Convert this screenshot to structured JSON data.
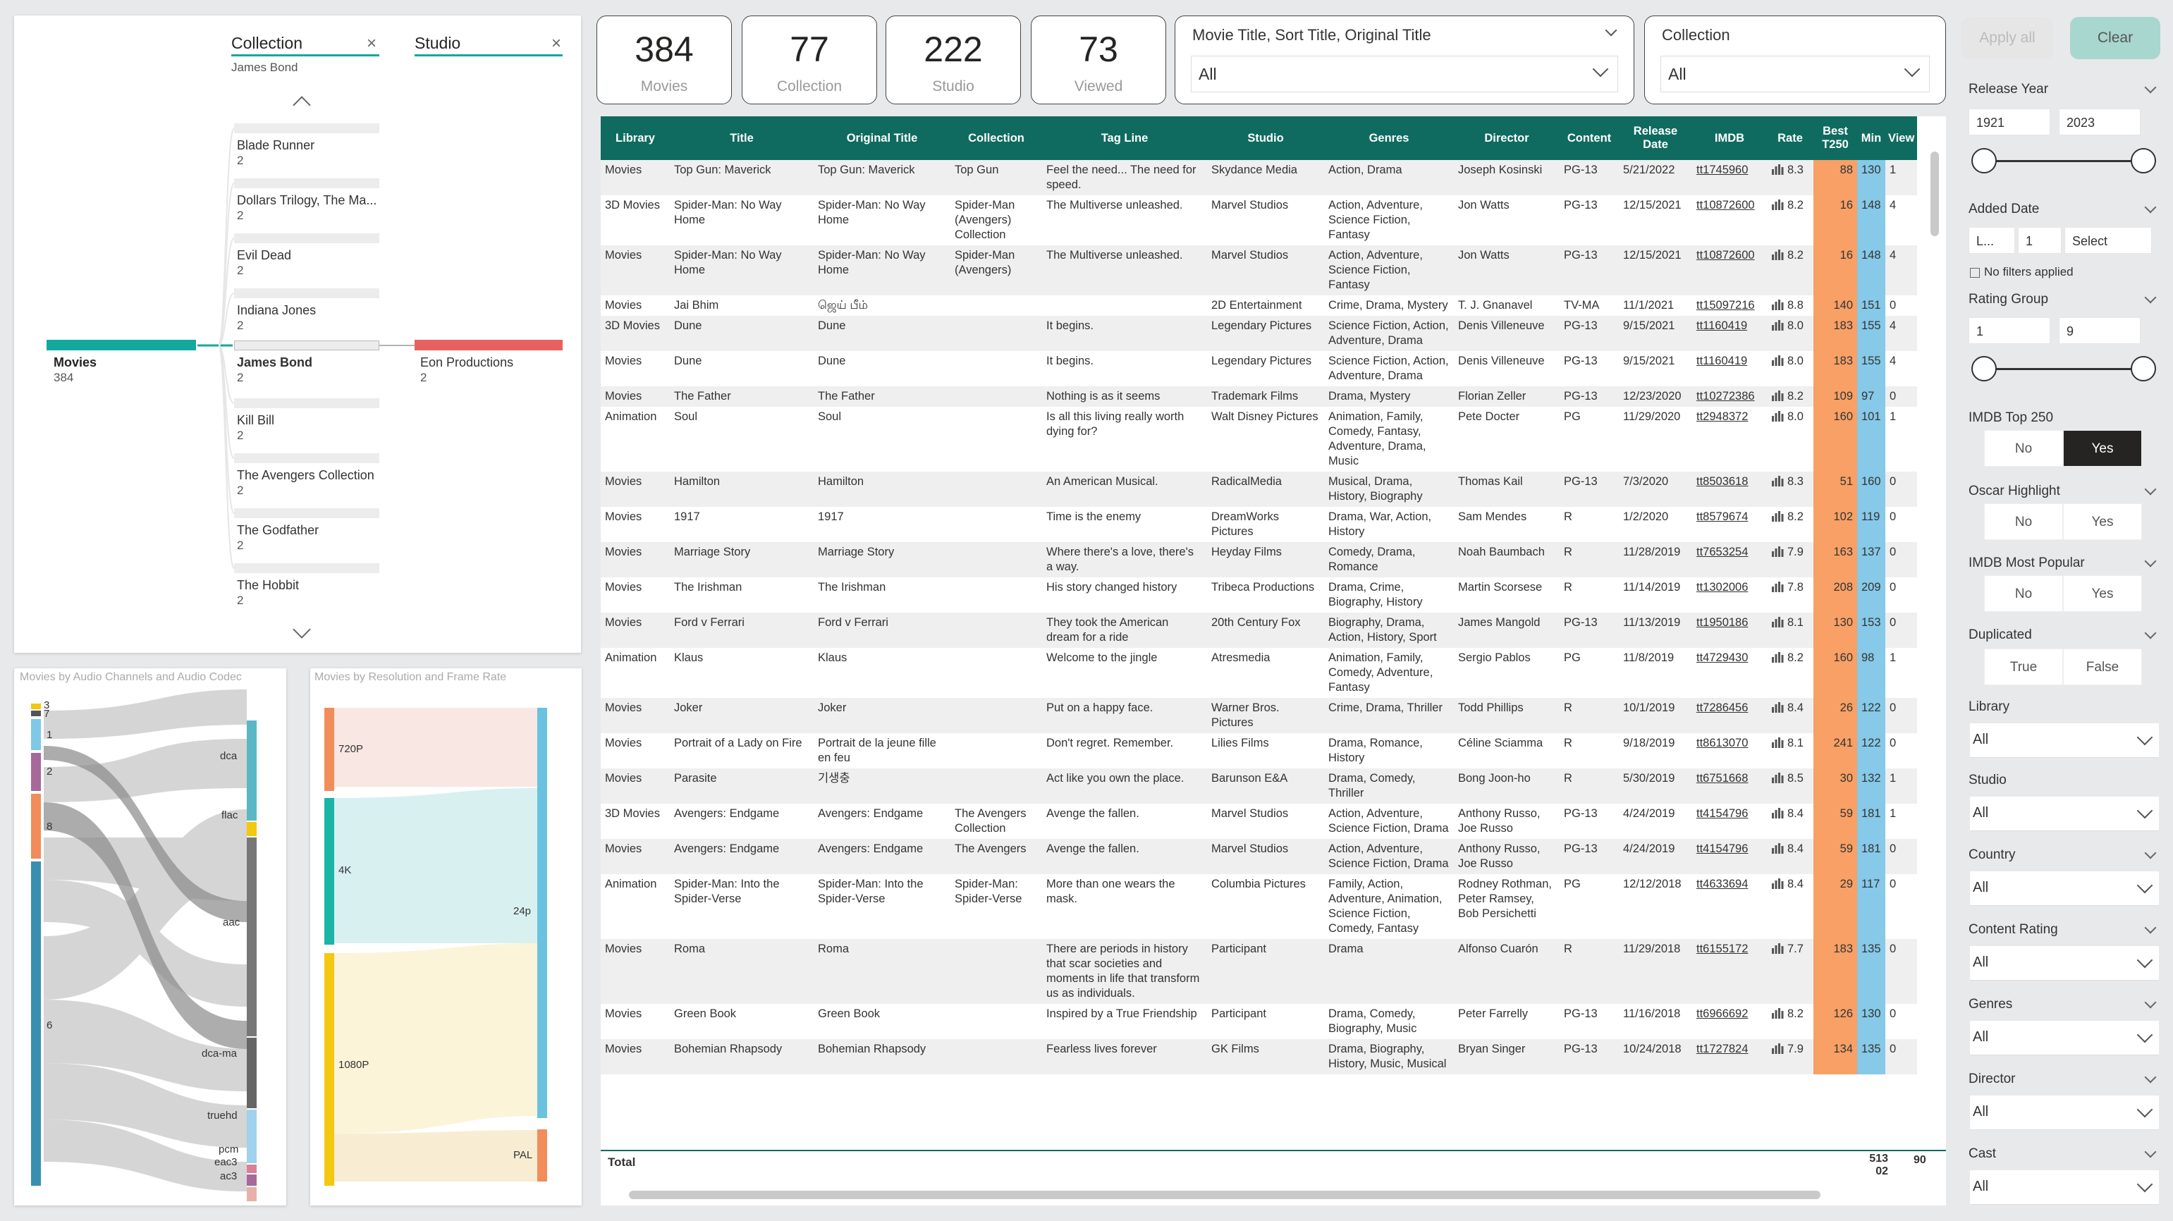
{
  "decomp": {
    "col1": {
      "header": "Collection",
      "filter": "James Bond"
    },
    "col2": {
      "header": "Studio"
    },
    "root": {
      "label": "Movies",
      "value": "384"
    },
    "nodes": [
      {
        "label": "Blade Runner",
        "value": "2"
      },
      {
        "label": "Dollars Trilogy, The Ma...",
        "value": "2"
      },
      {
        "label": "Evil Dead",
        "value": "2"
      },
      {
        "label": "Indiana Jones",
        "value": "2"
      },
      {
        "label": "James Bond",
        "value": "2"
      },
      {
        "label": "Kill Bill",
        "value": "2"
      },
      {
        "label": "The Avengers Collection",
        "value": "2"
      },
      {
        "label": "The Godfather",
        "value": "2"
      },
      {
        "label": "The Hobbit",
        "value": "2"
      }
    ],
    "studio_node": {
      "label": "Eon Productions",
      "value": "2"
    }
  },
  "audio_chart": {
    "title": "Movies by Audio Channels and Audio Codec",
    "left_labels": [
      "3",
      "7",
      "1",
      "2",
      "8",
      "6"
    ],
    "right_labels": [
      "dca",
      "flac",
      "aac",
      "dca-ma",
      "truehd",
      "pcm",
      "eac3",
      "ac3"
    ]
  },
  "res_chart": {
    "title": "Movies by Resolution and Frame Rate",
    "left_labels": [
      "720P",
      "4K",
      "1080P"
    ],
    "right_labels": [
      "24p",
      "PAL"
    ]
  },
  "kpis": [
    {
      "value": "384",
      "label": "Movies"
    },
    {
      "value": "77",
      "label": "Collection"
    },
    {
      "value": "222",
      "label": "Studio"
    },
    {
      "value": "73",
      "label": "Viewed"
    }
  ],
  "title_slicer": {
    "header": "Movie Title, Sort Title, Original Title",
    "value": "All"
  },
  "collection_slicer": {
    "header": "Collection",
    "value": "All"
  },
  "buttons": {
    "apply": "Apply all",
    "clear": "Clear"
  },
  "table": {
    "columns": [
      "Library",
      "Title",
      "Original Title",
      "Collection",
      "Tag Line",
      "Studio",
      "Genres",
      "Director",
      "Content",
      "Release Date",
      "IMDB",
      "Rate",
      "Best T250",
      "Min",
      "View"
    ],
    "rows": [
      [
        "Movies",
        "Top Gun: Maverick",
        "Top Gun: Maverick",
        "Top Gun",
        "Feel the need... The need for speed.",
        "Skydance Media",
        "Action, Drama",
        "Joseph Kosinski",
        "PG-13",
        "5/21/2022",
        "tt1745960",
        "8.3",
        "88",
        "130",
        "1"
      ],
      [
        "3D Movies",
        "Spider-Man: No Way Home",
        "Spider-Man: No Way Home",
        "Spider-Man (Avengers) Collection",
        "The Multiverse unleashed.",
        "Marvel Studios",
        "Action, Adventure, Science Fiction, Fantasy",
        "Jon Watts",
        "PG-13",
        "12/15/2021",
        "tt10872600",
        "8.2",
        "16",
        "148",
        "4"
      ],
      [
        "Movies",
        "Spider-Man: No Way Home",
        "Spider-Man: No Way Home",
        "Spider-Man (Avengers)",
        "The Multiverse unleashed.",
        "Marvel Studios",
        "Action, Adventure, Science Fiction, Fantasy",
        "Jon Watts",
        "PG-13",
        "12/15/2021",
        "tt10872600",
        "8.2",
        "16",
        "148",
        "4"
      ],
      [
        "Movies",
        "Jai Bhim",
        "ஜெய் பீம்",
        "",
        "",
        "2D Entertainment",
        "Crime, Drama, Mystery",
        "T. J. Gnanavel",
        "TV-MA",
        "11/1/2021",
        "tt15097216",
        "8.8",
        "140",
        "151",
        "0"
      ],
      [
        "3D Movies",
        "Dune",
        "Dune",
        "",
        "It begins.",
        "Legendary Pictures",
        "Science Fiction, Action, Adventure, Drama",
        "Denis Villeneuve",
        "PG-13",
        "9/15/2021",
        "tt1160419",
        "8.0",
        "183",
        "155",
        "4"
      ],
      [
        "Movies",
        "Dune",
        "Dune",
        "",
        "It begins.",
        "Legendary Pictures",
        "Science Fiction, Action, Adventure, Drama",
        "Denis Villeneuve",
        "PG-13",
        "9/15/2021",
        "tt1160419",
        "8.0",
        "183",
        "155",
        "4"
      ],
      [
        "Movies",
        "The Father",
        "The Father",
        "",
        "Nothing is as it seems",
        "Trademark Films",
        "Drama, Mystery",
        "Florian Zeller",
        "PG-13",
        "12/23/2020",
        "tt10272386",
        "8.2",
        "109",
        "97",
        "0"
      ],
      [
        "Animation",
        "Soul",
        "Soul",
        "",
        "Is all this living really worth dying for?",
        "Walt Disney Pictures",
        "Animation, Family, Comedy, Fantasy, Adventure, Drama, Music",
        "Pete Docter",
        "PG",
        "11/29/2020",
        "tt2948372",
        "8.0",
        "160",
        "101",
        "1"
      ],
      [
        "Movies",
        "Hamilton",
        "Hamilton",
        "",
        "An American Musical.",
        "RadicalMedia",
        "Musical, Drama, History, Biography",
        "Thomas Kail",
        "PG-13",
        "7/3/2020",
        "tt8503618",
        "8.3",
        "51",
        "160",
        "0"
      ],
      [
        "Movies",
        "1917",
        "1917",
        "",
        "Time is the enemy",
        "DreamWorks Pictures",
        "Drama, War, Action, History",
        "Sam Mendes",
        "R",
        "1/2/2020",
        "tt8579674",
        "8.2",
        "102",
        "119",
        "0"
      ],
      [
        "Movies",
        "Marriage Story",
        "Marriage Story",
        "",
        "Where there's a love, there's a way.",
        "Heyday Films",
        "Comedy, Drama, Romance",
        "Noah Baumbach",
        "R",
        "11/28/2019",
        "tt7653254",
        "7.9",
        "163",
        "137",
        "0"
      ],
      [
        "Movies",
        "The Irishman",
        "The Irishman",
        "",
        "His story changed history",
        "Tribeca Productions",
        "Drama, Crime, Biography, History",
        "Martin Scorsese",
        "R",
        "11/14/2019",
        "tt1302006",
        "7.8",
        "208",
        "209",
        "0"
      ],
      [
        "Movies",
        "Ford v Ferrari",
        "Ford v Ferrari",
        "",
        "They took the American dream for a ride",
        "20th Century Fox",
        "Biography, Drama, Action, History, Sport",
        "James Mangold",
        "PG-13",
        "11/13/2019",
        "tt1950186",
        "8.1",
        "130",
        "153",
        "0"
      ],
      [
        "Animation",
        "Klaus",
        "Klaus",
        "",
        "Welcome to the jingle",
        "Atresmedia",
        "Animation, Family, Comedy, Adventure, Fantasy",
        "Sergio Pablos",
        "PG",
        "11/8/2019",
        "tt4729430",
        "8.2",
        "160",
        "98",
        "1"
      ],
      [
        "Movies",
        "Joker",
        "Joker",
        "",
        "Put on a happy face.",
        "Warner Bros. Pictures",
        "Crime, Drama, Thriller",
        "Todd Phillips",
        "R",
        "10/1/2019",
        "tt7286456",
        "8.4",
        "26",
        "122",
        "0"
      ],
      [
        "Movies",
        "Portrait of a Lady on Fire",
        "Portrait de la jeune fille en feu",
        "",
        "Don't regret. Remember.",
        "Lilies Films",
        "Drama, Romance, History",
        "Céline Sciamma",
        "R",
        "9/18/2019",
        "tt8613070",
        "8.1",
        "241",
        "122",
        "0"
      ],
      [
        "Movies",
        "Parasite",
        "기생충",
        "",
        "Act like you own the place.",
        "Barunson E&A",
        "Drama, Comedy, Thriller",
        "Bong Joon-ho",
        "R",
        "5/30/2019",
        "tt6751668",
        "8.5",
        "30",
        "132",
        "1"
      ],
      [
        "3D Movies",
        "Avengers: Endgame",
        "Avengers: Endgame",
        "The Avengers Collection",
        "Avenge the fallen.",
        "Marvel Studios",
        "Action, Adventure, Science Fiction, Drama",
        "Anthony Russo, Joe Russo",
        "PG-13",
        "4/24/2019",
        "tt4154796",
        "8.4",
        "59",
        "181",
        "1"
      ],
      [
        "Movies",
        "Avengers: Endgame",
        "Avengers: Endgame",
        "The Avengers",
        "Avenge the fallen.",
        "Marvel Studios",
        "Action, Adventure, Science Fiction, Drama",
        "Anthony Russo, Joe Russo",
        "PG-13",
        "4/24/2019",
        "tt4154796",
        "8.4",
        "59",
        "181",
        "0"
      ],
      [
        "Animation",
        "Spider-Man: Into the Spider-Verse",
        "Spider-Man: Into the Spider-Verse",
        "Spider-Man: Spider-Verse",
        "More than one wears the mask.",
        "Columbia Pictures",
        "Family, Action, Adventure, Animation, Science Fiction, Comedy, Fantasy",
        "Rodney Rothman, Peter Ramsey, Bob Persichetti",
        "PG",
        "12/12/2018",
        "tt4633694",
        "8.4",
        "29",
        "117",
        "0"
      ],
      [
        "Movies",
        "Roma",
        "Roma",
        "",
        "There are periods in history that scar societies and moments in life that transform us as individuals.",
        "Participant",
        "Drama",
        "Alfonso Cuarón",
        "R",
        "11/29/2018",
        "tt6155172",
        "7.7",
        "183",
        "135",
        "0"
      ],
      [
        "Movies",
        "Green Book",
        "Green Book",
        "",
        "Inspired by a True Friendship",
        "Participant",
        "Drama, Comedy, Biography, Music",
        "Peter Farrelly",
        "PG-13",
        "11/16/2018",
        "tt6966692",
        "8.2",
        "126",
        "130",
        "0"
      ],
      [
        "Movies",
        "Bohemian Rhapsody",
        "Bohemian Rhapsody",
        "",
        "Fearless lives forever",
        "GK Films",
        "Drama, Biography, History, Music, Musical",
        "Bryan Singer",
        "PG-13",
        "10/24/2018",
        "tt1727824",
        "7.9",
        "134",
        "135",
        "0"
      ]
    ],
    "total_label": "Total",
    "total_min": "513 02",
    "total_view": "90"
  },
  "filters": {
    "release_year": {
      "label": "Release Year",
      "from": "1921",
      "to": "2023"
    },
    "added_date": {
      "label": "Added Date",
      "a": "L...",
      "b": "1",
      "c": "Select",
      "note": "No filters applied"
    },
    "rating_group": {
      "label": "Rating Group",
      "from": "1",
      "to": "9"
    },
    "imdb_top": {
      "label": "IMDB Top 250",
      "opt1": "No",
      "opt2": "Yes"
    },
    "oscar": {
      "label": "Oscar Highlight",
      "opt1": "No",
      "opt2": "Yes"
    },
    "imdb_pop": {
      "label": "IMDB Most Popular",
      "opt1": "No",
      "opt2": "Yes"
    },
    "duplicated": {
      "label": "Duplicated",
      "opt1": "True",
      "opt2": "False"
    },
    "library": {
      "label": "Library",
      "value": "All"
    },
    "studio": {
      "label": "Studio",
      "value": "All"
    },
    "country": {
      "label": "Country",
      "value": "All"
    },
    "content_rating": {
      "label": "Content Rating",
      "value": "All"
    },
    "genres": {
      "label": "Genres",
      "value": "All"
    },
    "director": {
      "label": "Director",
      "value": "All"
    },
    "cast": {
      "label": "Cast",
      "value": "All"
    }
  }
}
